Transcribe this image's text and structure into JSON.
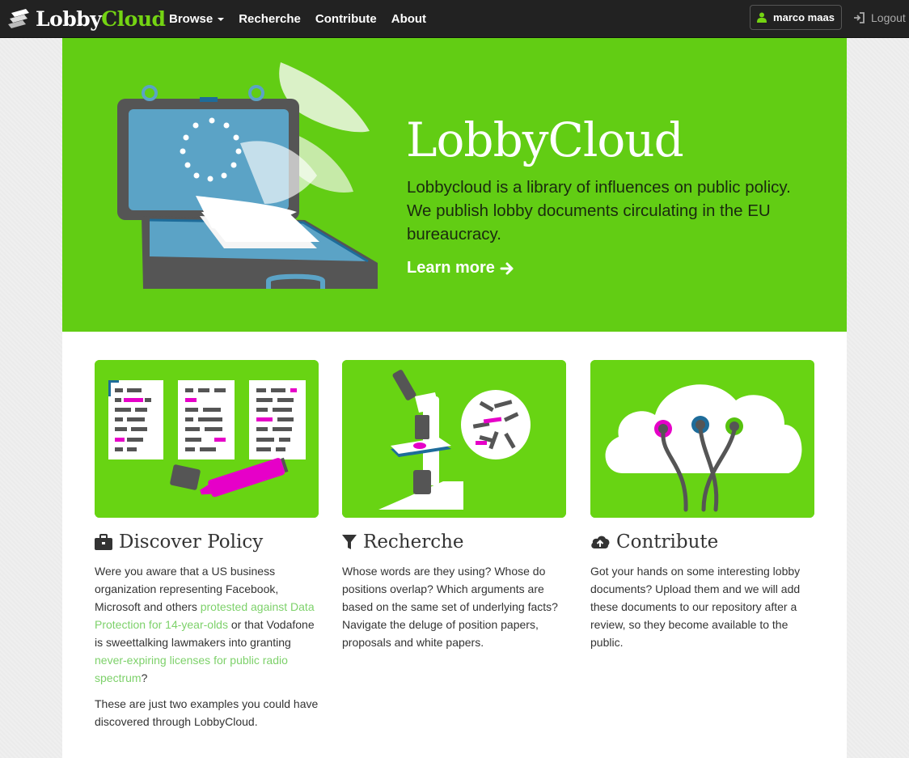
{
  "navbar": {
    "brand_lobby": "Lobby",
    "brand_cloud": "Cloud",
    "items": [
      {
        "label": "Browse",
        "dropdown": true
      },
      {
        "label": "Recherche"
      },
      {
        "label": "Contribute"
      },
      {
        "label": "About"
      }
    ],
    "user_name": "marco maas",
    "logout_label": "Logout"
  },
  "hero": {
    "title": "LobbyCloud",
    "lead": "Lobbycloud is a library of influences on public policy. We publish lobby documents circulating in the EU bureaucracy.",
    "learn_more": "Learn more"
  },
  "columns": [
    {
      "icon": "briefcase-icon",
      "title": "Discover Policy",
      "p1_before": "Were you aware that a US business organization representing Facebook, Microsoft and others ",
      "p1_link1": "protested against Data Protection for 14-year-olds",
      "p1_mid": " or that Vodafone is sweettalking lawmakers into granting ",
      "p1_link2": "never-expiring licenses for public radio spectrum",
      "p1_after": "?",
      "p2": "These are just two examples you could have discovered through LobbyCloud."
    },
    {
      "icon": "filter-icon",
      "title": "Recherche",
      "p1": "Whose words are they using? Whose do positions overlap? Which arguments are based on the same set of underlying facts? Navigate the deluge of position papers, proposals and white papers."
    },
    {
      "icon": "cloud-upload-icon",
      "title": "Contribute",
      "p1": "Got your hands on some interesting lobby documents? Upload them and we will add these documents to our repository after a review, so they become available to the public."
    }
  ],
  "colors": {
    "brand_green": "#74d412",
    "hero_green": "#62cd14",
    "card_green": "#68d413",
    "link_green": "#7dd16a",
    "magenta": "#e600c8"
  }
}
